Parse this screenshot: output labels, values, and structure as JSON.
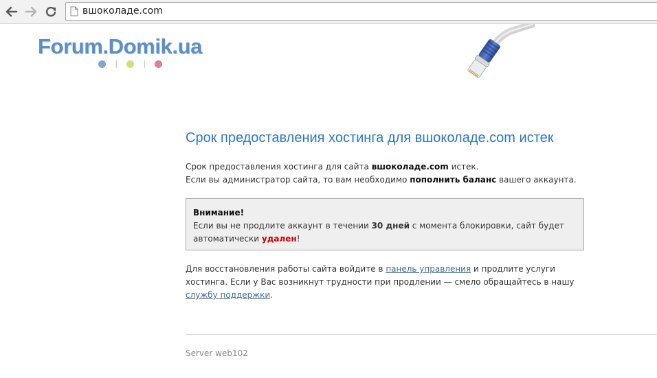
{
  "browser": {
    "url": "вшоколаде.com",
    "back_icon": "arrow-left-icon",
    "forward_icon": "arrow-right-icon",
    "reload_icon": "reload-icon"
  },
  "logo": {
    "text": "Forum.Domik.ua",
    "dot_colors": [
      "#7fa6d2",
      "#d5dc7a",
      "#dc7f9a"
    ]
  },
  "main": {
    "headline": "Срок предоставления хостинга для вшоколаде.com истек",
    "intro": {
      "line1_a": "Срок предоставления хостинга для сайта ",
      "line1_site": "вшоколаде.com",
      "line1_b": " истек.",
      "line2_a": "Если вы администратор сайта, то вам необходимо ",
      "line2_bold": "пополнить баланс",
      "line2_b": " вашего аккаунта."
    },
    "notice": {
      "title": "Внимание!",
      "text_a": "Если вы не продлите аккаунт в течении ",
      "text_days": "30 дней",
      "text_b": " с момента блокировки, сайт будет автоматически ",
      "text_deleted": "удален",
      "text_end": "!"
    },
    "restore": {
      "text_a": "Для восстановления работы сайта войдите в ",
      "link_panel": "панель управления",
      "text_b": " и продлите услуги хостинга. Если у Вас возникнут трудности при продлении — смело обращайтесь в нашу ",
      "link_support": "службу поддержки",
      "text_end": "."
    },
    "footer": "Server web102"
  },
  "colors": {
    "headline": "#2d77c4",
    "logo": "#5b8fc5",
    "danger": "#cc0000",
    "link": "#3d6d9c"
  }
}
